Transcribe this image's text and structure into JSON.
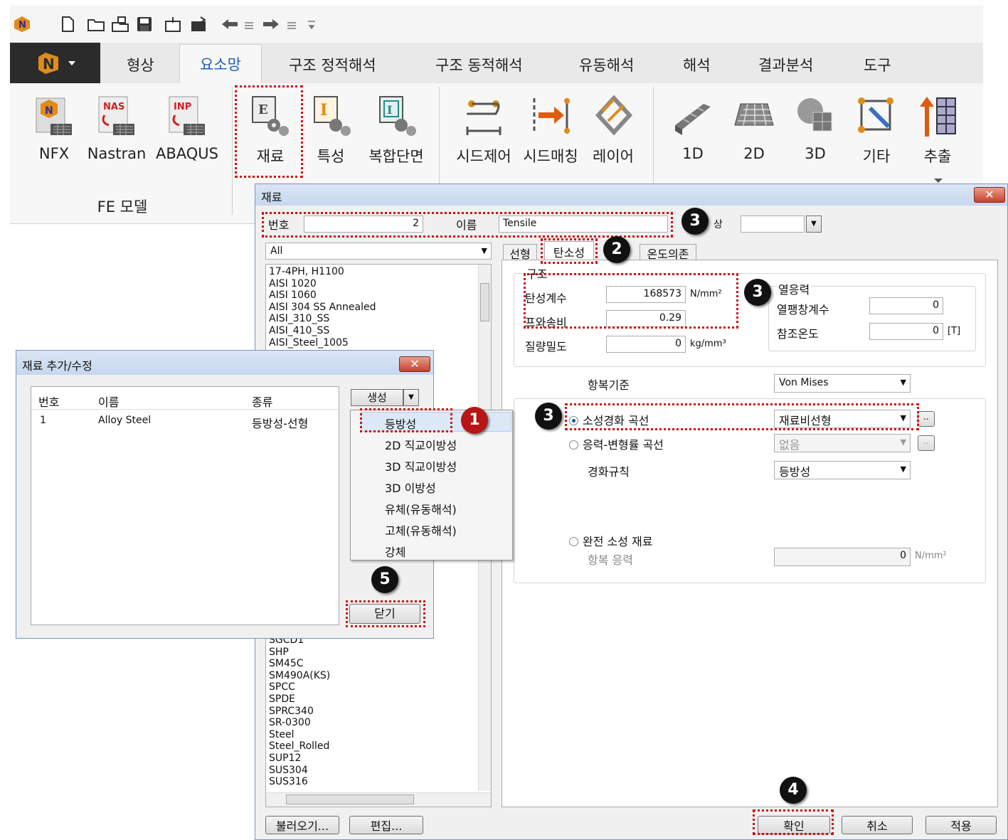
{
  "quick_access": {
    "icons": [
      "app-logo-icon",
      "new-file-icon",
      "open-folder-icon",
      "open-model-icon",
      "save-icon",
      "import-icon",
      "export-icon",
      "undo-icon",
      "undo-list-icon",
      "redo-icon",
      "redo-list-icon",
      "customize-icon"
    ]
  },
  "ribbon_tabs": {
    "app_menu": "N ▾",
    "tabs": [
      "형상",
      "요소망",
      "구조 정적해석",
      "구조 동적해석",
      "유동해석",
      "해석",
      "결과분석",
      "도구"
    ],
    "active": "요소망"
  },
  "ribbon": {
    "fe_model": {
      "nfx": "NFX",
      "nastran": "Nastran",
      "abaqus": "ABAQUS",
      "group_label": "FE 모델"
    },
    "material": "재료",
    "property": "특성",
    "composite": "복합단면",
    "seed_control": "시드제어",
    "seed_matching": "시드매칭",
    "layer": "레이어",
    "mesh_1d": "1D",
    "mesh_2d": "2D",
    "mesh_3d": "3D",
    "other": "기타",
    "extract": "추출"
  },
  "material_window": {
    "title": "재료",
    "close": "✕",
    "number_label": "번호",
    "number_value": "2",
    "name_label": "이름",
    "name_value": "Tensile",
    "phase_label": "상",
    "filter_value": "All",
    "list_top": [
      "17-4PH, H1100",
      "AISI 1020",
      "AISI 1060",
      "AISI 304 SS Annealed",
      "AISI_310_SS",
      "AISI_410_SS",
      "AISI_Steel_1005"
    ],
    "list_bottom": [
      "SGCD1",
      "SHP",
      "SM45C",
      "SM490A(KS)",
      "SPCC",
      "SPDE",
      "SPRC340",
      "SR-0300",
      "Steel",
      "Steel_Rolled",
      "SUP12",
      "SUS304",
      "SUS316"
    ],
    "tabs": [
      "선형",
      "탄소성",
      "온도의존"
    ],
    "structure_group": "구조",
    "elastic_modulus_label": "탄성계수",
    "elastic_modulus_value": "168573",
    "elastic_modulus_unit": "N/mm²",
    "poisson_label": "프와송비",
    "poisson_value": "0.29",
    "density_label": "질량밀도",
    "density_value": "0",
    "density_unit": "kg/mm³",
    "thermal_group": "열응력",
    "thermal_expansion_label": "열팽창계수",
    "thermal_expansion_value": "0",
    "ref_temp_label": "참조온도",
    "ref_temp_value": "0",
    "ref_temp_unit": "[T]",
    "yield_criterion_label": "항복기준",
    "yield_criterion_value": "Von Mises",
    "hardening_curve_label": "소성경화 곡선",
    "hardening_curve_value": "재료비선형",
    "stress_strain_label": "응력-변형률 곡선",
    "stress_strain_value": "없음",
    "hardening_rule_label": "경화규칙",
    "hardening_rule_value": "등방성",
    "perfect_plastic_label": "완전 소성 재료",
    "yield_stress_label": "항복 응력",
    "yield_stress_value": "0",
    "yield_stress_unit": "N/mm²",
    "more_button": "..",
    "load_button": "불러오기...",
    "edit_button": "편집...",
    "ok_button": "확인",
    "cancel_button": "취소",
    "apply_button": "적용"
  },
  "add_dialog": {
    "title": "재료 추가/수정",
    "close": "✕",
    "columns": [
      "번호",
      "이름",
      "종류"
    ],
    "rows": [
      {
        "no": "1",
        "name": "Alloy Steel",
        "type": "등방성-선형"
      }
    ],
    "create_button": "생성",
    "close_button": "닫기"
  },
  "create_menu": [
    "등방성",
    "2D 직교이방성",
    "3D 직교이방성",
    "3D 이방성",
    "유체(유동해석)",
    "고체(유동해석)",
    "강체"
  ],
  "callouts": {
    "b1": "1",
    "b2": "2",
    "b3a": "3",
    "b3b": "3",
    "b3c": "3",
    "b4": "4",
    "b5": "5"
  }
}
